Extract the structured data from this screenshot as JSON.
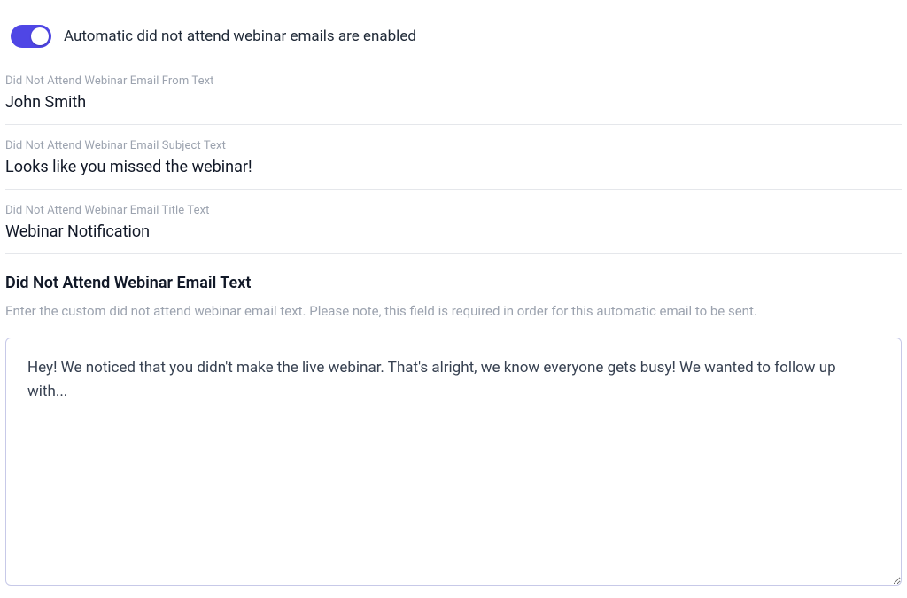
{
  "toggle": {
    "on": true,
    "label": "Automatic did not attend webinar emails are enabled"
  },
  "fields": {
    "from": {
      "label": "Did Not Attend Webinar Email From Text",
      "value": "John Smith"
    },
    "subject": {
      "label": "Did Not Attend Webinar Email Subject Text",
      "value": "Looks like you missed the webinar!"
    },
    "title": {
      "label": "Did Not Attend Webinar Email Title Text",
      "value": "Webinar Notification"
    }
  },
  "body_section": {
    "heading": "Did Not Attend Webinar Email Text",
    "help": "Enter the custom did not attend webinar email text. Please note, this field is required in order for this automatic email to be sent.",
    "value": "Hey! We noticed that you didn't make the live webinar. That's alright, we know everyone gets busy! We wanted to follow up with..."
  }
}
